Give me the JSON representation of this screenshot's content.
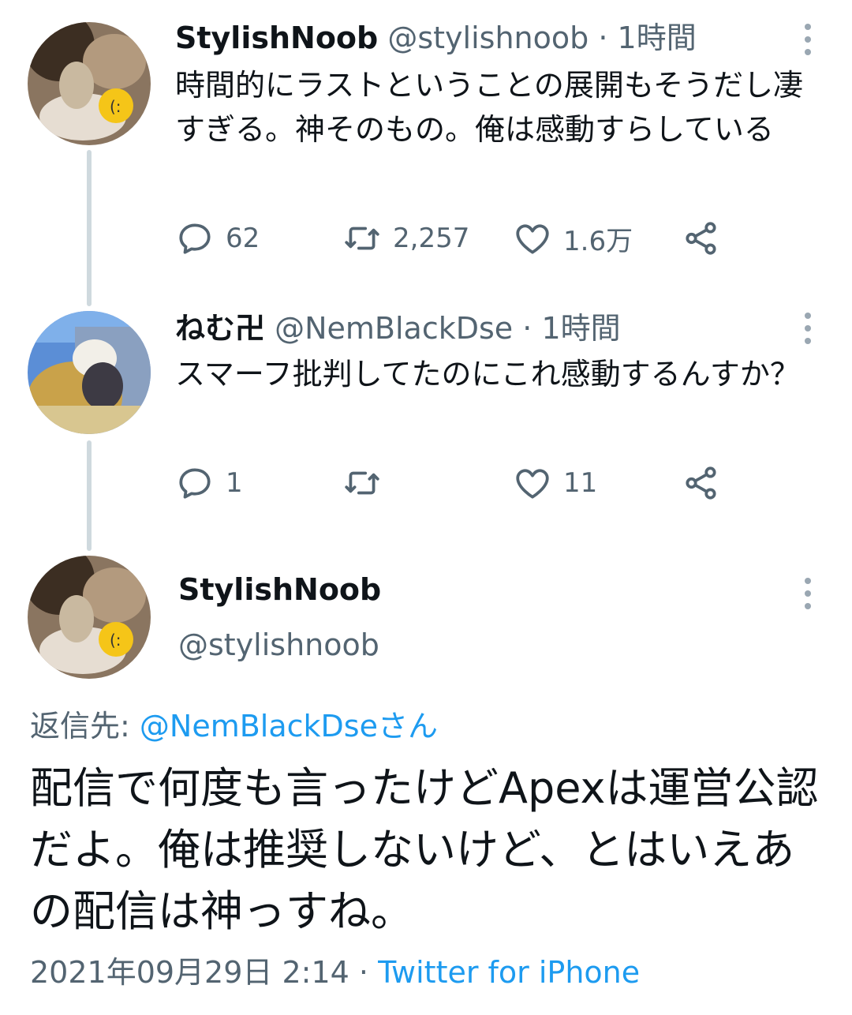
{
  "tweet1": {
    "name": "StylishNoob",
    "handle": "@stylishnoob",
    "separator": "·",
    "time": "1時間",
    "text": "時間的にラストということの展開もそうだし凄すぎる。神そのもの。俺は感動すらしている",
    "replies": "62",
    "retweets": "2,257",
    "likes": "1.6万",
    "icons": [
      "reply-icon",
      "retweet-icon",
      "like-icon",
      "share-icon",
      "more-icon"
    ]
  },
  "tweet2": {
    "name": "ねむ卍",
    "handle": "@NemBlackDse",
    "separator": "·",
    "time": "1時間",
    "text": "スマーフ批判してたのにこれ感動するんすか？",
    "replies": "1",
    "retweets": "",
    "likes": "11"
  },
  "main_tweet": {
    "name": "StylishNoob",
    "handle": "@stylishnoob",
    "reply_to_label": "返信先:",
    "reply_to_link": "@NemBlackDseさん",
    "text": "配信で何度も言ったけどApexは運営公認だよ。俺は推奨しないけど、とはいえあの配信は神っすね。",
    "date": "2021年09月29日 2:14",
    "separator": "·",
    "source": "Twitter for iPhone"
  },
  "colors": {
    "text": "#0f1419",
    "muted": "#536471",
    "link": "#1d9bf0",
    "thread_line": "#cfd9de"
  }
}
